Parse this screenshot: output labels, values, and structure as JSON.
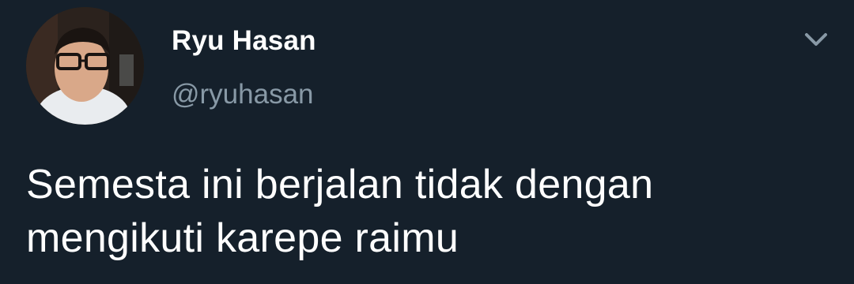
{
  "tweet": {
    "author": {
      "display_name": "Ryu Hasan",
      "handle": "@ryuhasan"
    },
    "text_line_1": "Semesta ini berjalan tidak dengan",
    "text_line_2": "mengikuti karepe raimu"
  },
  "icons": {
    "menu_caret": "chevron-down-icon"
  },
  "colors": {
    "background": "#15202b",
    "primary_text": "#ffffff",
    "secondary_text": "#8899a6"
  }
}
